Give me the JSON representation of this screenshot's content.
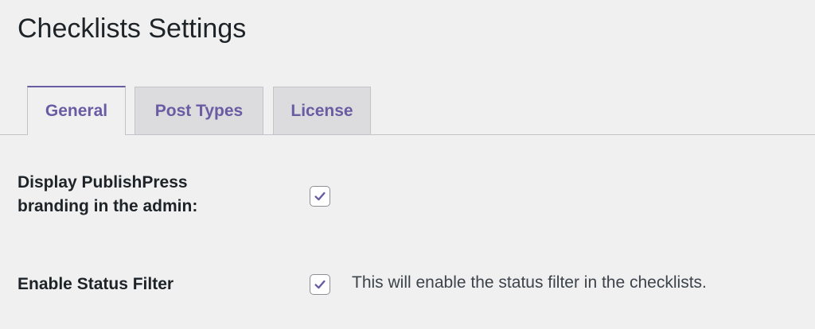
{
  "page": {
    "title": "Checklists Settings"
  },
  "tabs": [
    {
      "label": "General",
      "active": true
    },
    {
      "label": "Post Types",
      "active": false
    },
    {
      "label": "License",
      "active": false
    }
  ],
  "settings": [
    {
      "label_line1": "Display PublishPress",
      "label_line2": "branding in the admin:",
      "checked": true,
      "description": ""
    },
    {
      "label": "Enable Status Filter",
      "checked": true,
      "description": "This will enable the status filter in the checklists."
    }
  ],
  "colors": {
    "accent": "#6a5ca3",
    "background": "#f0f0f1",
    "inactive_tab": "#dcdcde"
  },
  "icons": {
    "checkmark": "check-icon"
  }
}
